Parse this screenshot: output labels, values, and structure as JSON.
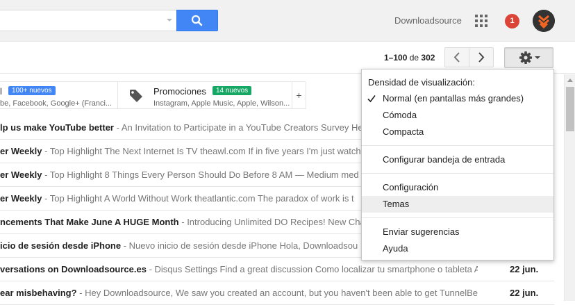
{
  "header": {
    "user_name": "Downloadsource",
    "notification_count": "1",
    "icons": {
      "search": "search-icon",
      "apps": "apps-grid-icon",
      "avatar": "downloadsource-logo-icon"
    },
    "colors": {
      "search_button": "#4285f4",
      "notification": "#db4437"
    }
  },
  "pager": {
    "range": "1–100",
    "of": "de",
    "total": "302"
  },
  "tabs": [
    {
      "title": "l",
      "badge": "100+ nuevos",
      "badge_color": "#4285f4",
      "subtitle": "be, Facebook, Google+ (Franci..."
    },
    {
      "title": "Promociones",
      "badge": "14 nuevos",
      "badge_color": "#16a765",
      "subtitle": "Instagram, Apple Music, Apple, Wilson..."
    }
  ],
  "tab_add": "+",
  "emails": [
    {
      "subject": "lp us make YouTube better",
      "snippet": " - An Invitation to Participate in a YouTube Creators Survey Hel",
      "date": ""
    },
    {
      "subject": "er Weekly",
      "snippet": " - Top Highlight The Next Internet Is TV theawl.com If in five years I'm just watch",
      "date": ""
    },
    {
      "subject": "er Weekly",
      "snippet": " - Top Highlight 8 Things Every Person Should Do Before 8 AM — Medium med",
      "date": ""
    },
    {
      "subject": "er Weekly",
      "snippet": " - Top Highlight A World Without Work theatlantic.com The paradox of work is t",
      "date": ""
    },
    {
      "subject": "ncements That Make June A HUGE Month",
      "snippet": " - Introducing Unlimited DO Recipes! New Cha",
      "date": ""
    },
    {
      "subject": "icio de sesión desde iPhone",
      "snippet": " - Nuevo inicio de sesión desde iPhone Hola, Downloadsou",
      "date": ""
    },
    {
      "subject": "versations on Downloadsource.es",
      "snippet": " - Disqus Settings Find a great discussion Como localizar tu smartphone o tableta A",
      "date": "22 jun."
    },
    {
      "subject": "ear misbehaving?",
      "snippet": " - Hey Downloadsource, We saw you created an account, but you haven't been able to get TunnelBe",
      "date": "22 jun."
    }
  ],
  "settings_menu": {
    "density_label": "Densidad de visualización:",
    "density_options": [
      "Normal (en pantallas más grandes)",
      "Cómoda",
      "Compacta"
    ],
    "selected_density": "Normal (en pantallas más grandes)",
    "configure_inbox": "Configurar bandeja de entrada",
    "settings": "Configuración",
    "themes": "Temas",
    "send_feedback": "Enviar sugerencias",
    "help": "Ayuda",
    "hovered_item": "Temas"
  }
}
